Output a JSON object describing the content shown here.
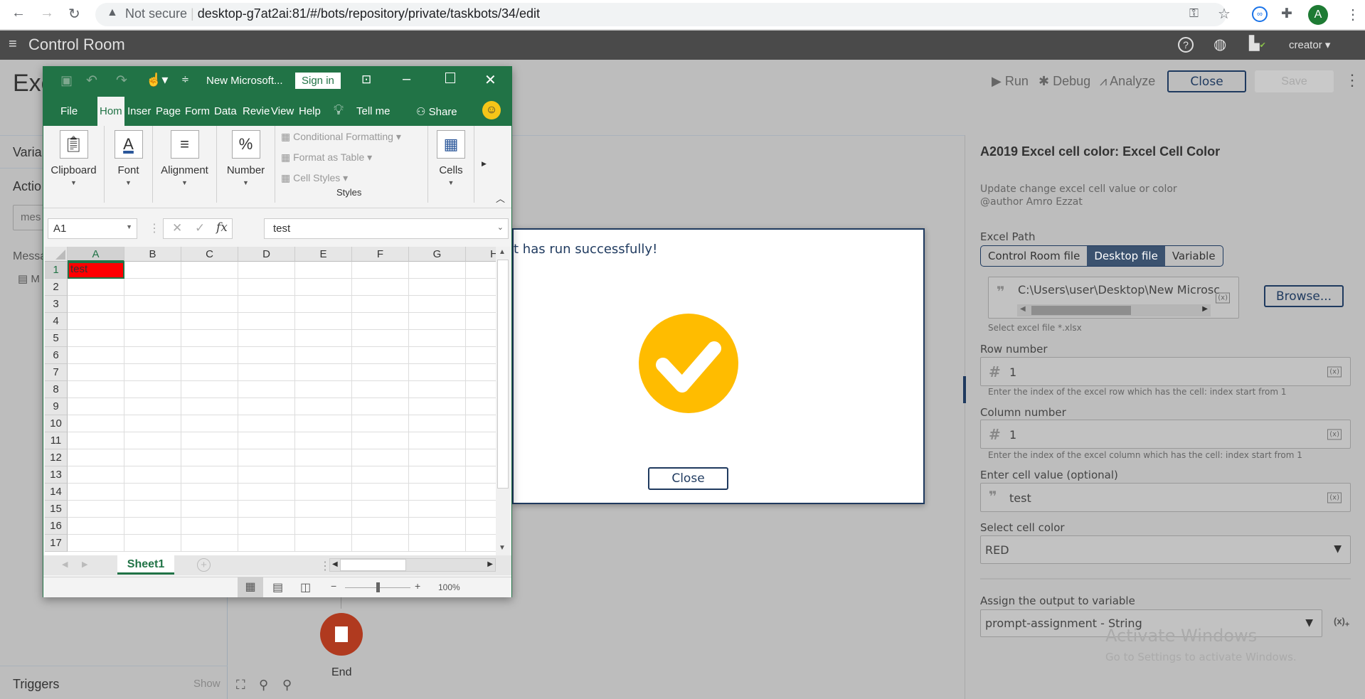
{
  "browser": {
    "not_secure": "Not secure",
    "url": "desktop-g7at2ai:81/#/bots/repository/private/taskbots/34/edit",
    "avatar_letter": "A"
  },
  "app": {
    "title": "Control Room",
    "user": "creator"
  },
  "editor": {
    "title_partial": "Exc",
    "run": "Run",
    "debug": "Debug",
    "analyze": "Analyze",
    "close": "Close",
    "save": "Save"
  },
  "left": {
    "variables_partial": "Varia",
    "actions_partial": "Actio",
    "search_partial": "mes",
    "message_partial": "Messa",
    "message_item_partial": "M",
    "triggers": "Triggers",
    "show": "Show"
  },
  "canvas": {
    "end_label": "End"
  },
  "excel": {
    "doc_title": "New Microsoft...",
    "sign_in": "Sign in",
    "tabs": [
      "File",
      "Hom",
      "Inser",
      "Page",
      "Form",
      "Data",
      "Revie",
      "View",
      "Help"
    ],
    "tell_me": "Tell me",
    "share": "Share",
    "groups": {
      "clipboard": "Clipboard",
      "font": "Font",
      "alignment": "Alignment",
      "number": "Number",
      "cells": "Cells",
      "styles": "Styles"
    },
    "styles_items": [
      "Conditional Formatting",
      "Format as Table",
      "Cell Styles"
    ],
    "name_box": "A1",
    "formula": "test",
    "columns": [
      "A",
      "B",
      "C",
      "D",
      "E",
      "F",
      "G",
      "H"
    ],
    "rows": [
      "1",
      "2",
      "3",
      "4",
      "5",
      "6",
      "7",
      "8",
      "9",
      "10",
      "11",
      "12",
      "13",
      "14",
      "15",
      "16",
      "17"
    ],
    "a1_value": "test",
    "a1_fill": "#ff0000",
    "sheet": "Sheet1",
    "zoom": "100%",
    "zoom_fraction": 0.5
  },
  "dialog": {
    "message_partial": "t has run successfully!",
    "close": "Close",
    "check_color": "#ffbc00"
  },
  "panel": {
    "title": "A2019 Excel cell color: Excel Cell Color",
    "desc1": "Update change excel cell value or color",
    "desc2": "@author Amro Ezzat",
    "excel_path_label": "Excel Path",
    "path_options": [
      "Control Room file",
      "Desktop file",
      "Variable"
    ],
    "path_value": "C:\\Users\\user\\Desktop\\New Microsc",
    "browse": "Browse...",
    "path_help": "Select excel file *.xlsx",
    "row_label": "Row number",
    "row_value": "1",
    "row_help": "Enter the index of the excel row which has the cell: index start from 1",
    "col_label": "Column number",
    "col_value": "1",
    "col_help": "Enter the index of the excel column which has the cell: index start from 1",
    "cell_value_label": "Enter cell value (optional)",
    "cell_value": "test",
    "color_label": "Select cell color",
    "color_value": "RED",
    "assign_label": "Assign the output to variable",
    "assign_value": "prompt-assignment - String",
    "var_icon": "(x)"
  },
  "watermark": {
    "line1": "Activate Windows",
    "line2": "Go to Settings to activate Windows."
  }
}
